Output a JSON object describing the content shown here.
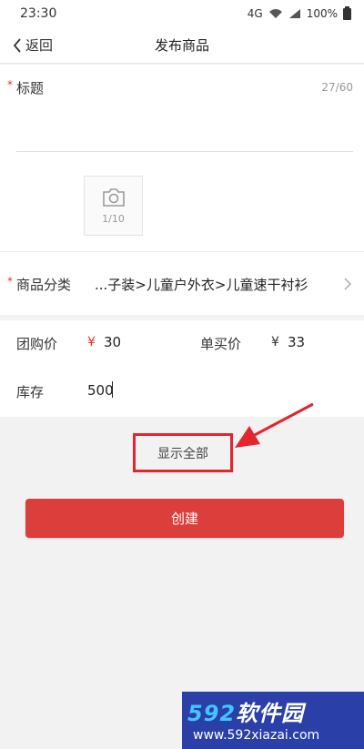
{
  "status_bar": {
    "time": "23:30",
    "network": "4G",
    "battery": "100%"
  },
  "nav": {
    "back_label": "返回",
    "title": "发布商品"
  },
  "title_field": {
    "required_mark": "*",
    "label": "标题",
    "count": "27/60"
  },
  "photo": {
    "count": "1/10"
  },
  "category": {
    "required_mark": "*",
    "label": "商品分类",
    "value": "...子装>儿童户外衣>儿童速干衬衫"
  },
  "pricing": {
    "group_label": "团购价",
    "group_currency": "¥",
    "group_value": "30",
    "single_label": "单买价",
    "single_currency": "¥",
    "single_value": "33",
    "stock_label": "库存",
    "stock_value": "500"
  },
  "show_all_label": "显示全部",
  "create_label": "创建",
  "watermark": {
    "brand_num": "592",
    "brand_text": "软件园",
    "url": "www.592xiazai.com"
  },
  "colors": {
    "accent_red": "#dc3f3b",
    "highlight_red": "#e4252e",
    "watermark_blue": "#2a3fa8"
  }
}
